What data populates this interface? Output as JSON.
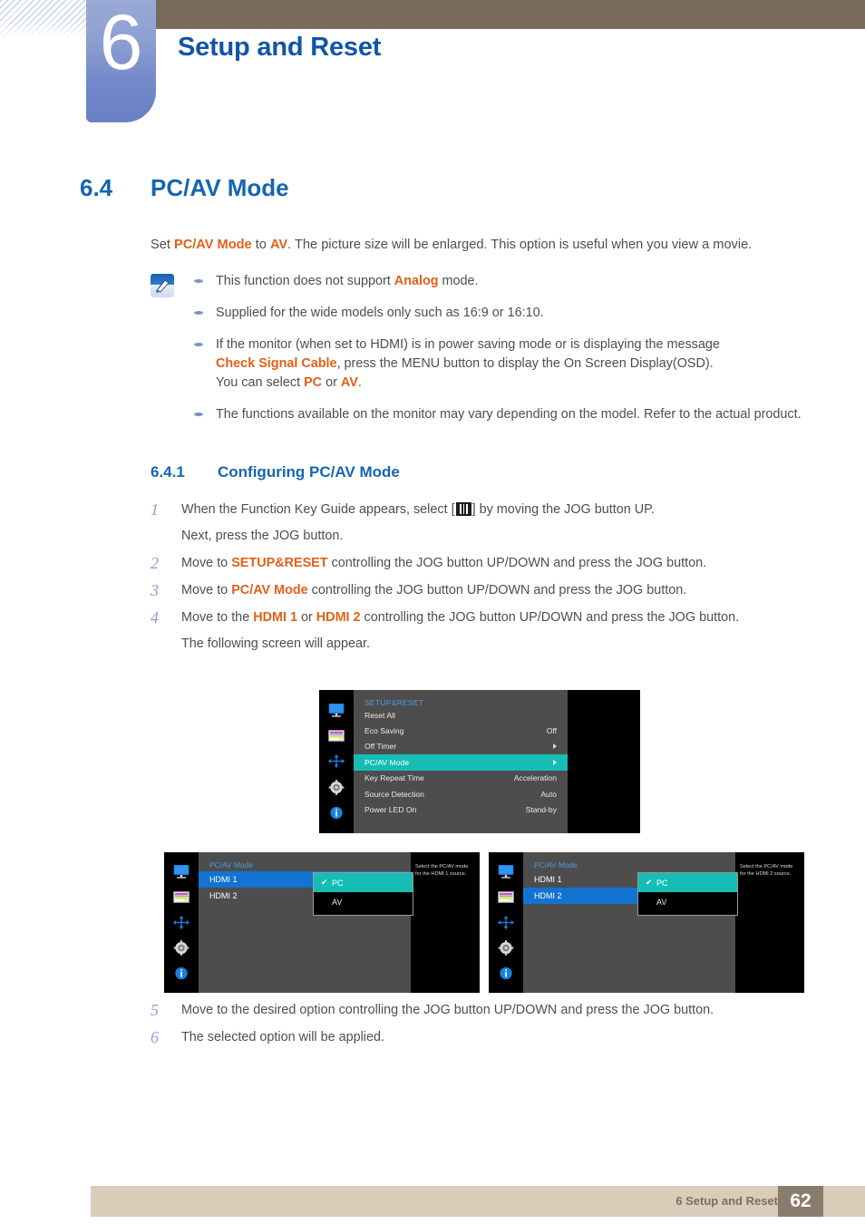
{
  "header": {
    "chapter_number": "6",
    "chapter_title": "Setup and Reset"
  },
  "section": {
    "number": "6.4",
    "title": "PC/AV Mode"
  },
  "intro": {
    "part1": "Set ",
    "hl1": "PC/AV Mode",
    "part2": " to ",
    "hl2": "AV",
    "part3": ". The picture size will be enlarged. This option is useful when you view a movie."
  },
  "note": {
    "icon": "note-pencil-icon",
    "items": [
      {
        "a": "This function does not support ",
        "hl": "Analog",
        "b": " mode."
      },
      {
        "a": "Supplied for the wide models only such as 16:9 or 16:10.",
        "hl": "",
        "b": ""
      },
      {
        "line1": "If the monitor (when set to HDMI) is in power saving mode or is displaying the message",
        "hl1": "Check Signal Cable",
        "line2": ", press the MENU button to display the On Screen Display(OSD).",
        "line3a": "You can select ",
        "hl2": "PC",
        "line3b": " or ",
        "hl3": "AV",
        "line3c": "."
      },
      {
        "a": "The functions available on the monitor may vary depending on the model. Refer to the actual product.",
        "hl": "",
        "b": ""
      }
    ]
  },
  "subsection": {
    "number": "6.4.1",
    "title": "Configuring PC/AV Mode"
  },
  "steps_upper": [
    {
      "num": "1",
      "line1a": "When the Function Key Guide appears, select [",
      "glyph": "menu-icon",
      "line1b": "] by moving the JOG button UP.",
      "line2": "Next, press the JOG button."
    },
    {
      "num": "2",
      "a": "Move to ",
      "hl": "SETUP&RESET",
      "b": " controlling the JOG button UP/DOWN and press the JOG button."
    },
    {
      "num": "3",
      "a": "Move to ",
      "hl": "PC/AV Mode",
      "b": " controlling the JOG button UP/DOWN and press the JOG button."
    },
    {
      "num": "4",
      "a": "Move to the ",
      "hl": "HDMI 1",
      "mid": " or ",
      "hl2": "HDMI 2",
      "b": " controlling the JOG button UP/DOWN and press the JOG button.",
      "line2": "The following screen will appear."
    }
  ],
  "steps_lower": [
    {
      "num": "5",
      "a": "Move to the desired option controlling the JOG button UP/DOWN and press the JOG button."
    },
    {
      "num": "6",
      "a": "The selected option will be applied."
    }
  ],
  "osd_main": {
    "title": "SETUP&RESET",
    "rail_icons": [
      "monitor-icon",
      "picture-icon",
      "arrows-move-icon",
      "gear-icon",
      "info-icon"
    ],
    "rows": [
      {
        "label": "Reset All",
        "value": "",
        "arrow": false,
        "selected": false
      },
      {
        "label": "Eco Saving",
        "value": "Off",
        "arrow": false,
        "selected": false
      },
      {
        "label": "Off Timer",
        "value": "",
        "arrow": true,
        "selected": false
      },
      {
        "label": "PC/AV Mode",
        "value": "",
        "arrow": true,
        "selected": true
      },
      {
        "label": "Key Repeat Time",
        "value": "Acceleration",
        "arrow": false,
        "selected": false
      },
      {
        "label": "Source Detection",
        "value": "Auto",
        "arrow": false,
        "selected": false
      },
      {
        "label": "Power LED On",
        "value": "Stand-by",
        "arrow": false,
        "selected": false
      }
    ]
  },
  "osd_hdmi1": {
    "title": "PC/AV Mode",
    "rows": [
      {
        "label": "HDMI 1",
        "selected": true
      },
      {
        "label": "HDMI 2",
        "selected": false
      }
    ],
    "popup": [
      {
        "label": "PC",
        "checked": true,
        "check": "✔"
      },
      {
        "label": "AV",
        "checked": false,
        "check": ""
      }
    ],
    "help_line1": "Select the PC/AV mode",
    "help_line2": "for the HDMI 1 source."
  },
  "osd_hdmi2": {
    "title": "PC/AV Mode",
    "rows": [
      {
        "label": "HDMI 1",
        "selected": false
      },
      {
        "label": "HDMI 2",
        "selected": true
      }
    ],
    "popup": [
      {
        "label": "PC",
        "checked": true,
        "check": "✔"
      },
      {
        "label": "AV",
        "checked": false,
        "check": ""
      }
    ],
    "help_line1": "Select the PC/AV mode",
    "help_line2": "for the HDMI 2 source."
  },
  "footer": {
    "label": "6 Setup and Reset",
    "page": "62"
  },
  "colors": {
    "accent_blue": "#1565b0",
    "highlight_orange": "#e2601a",
    "osd_selected_teal": "#15bdb4",
    "osd_selected_blue": "#1273d2",
    "header_brown": "#786a58",
    "footer_beige": "#d9cdb9",
    "footer_page_brown": "#8a7c6d"
  }
}
